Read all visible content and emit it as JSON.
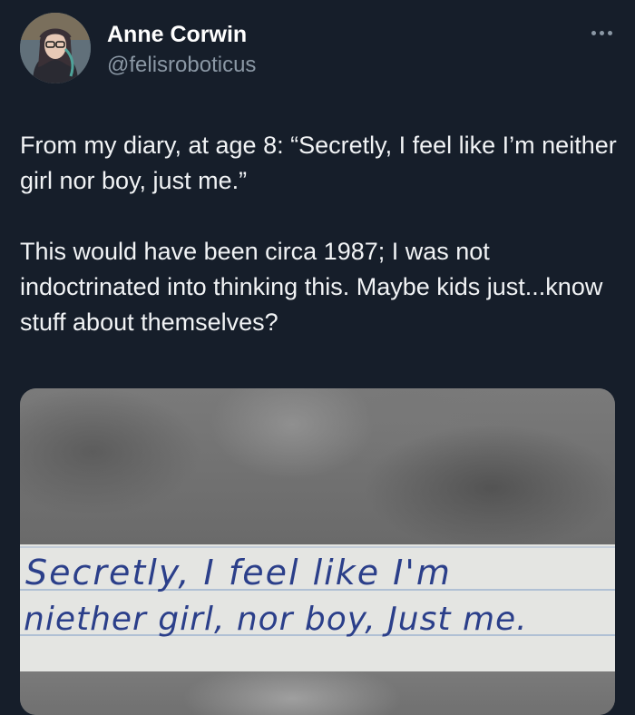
{
  "author": {
    "display_name": "Anne Corwin",
    "handle": "@felisroboticus"
  },
  "tweet": {
    "paragraphs": [
      "From my diary, at age 8: “Secretly, I feel like I’m neither girl nor boy, just me.”",
      "This would have been circa 1987; I was not indoctrinated into thinking this. Maybe kids just...know stuff about themselves?"
    ]
  },
  "media": {
    "handwriting_lines": [
      "Secretly, I feel like I'm",
      "niether girl, nor boy, Just me."
    ]
  },
  "colors": {
    "background": "#161e2a",
    "text": "#ffffff",
    "secondary_text": "#8b98a5",
    "paper": "#e4e5e2",
    "ink": "#2b3f8a",
    "ruled_line": "#9fb3cf"
  },
  "icons": {
    "more": "more-horizontal-icon"
  }
}
